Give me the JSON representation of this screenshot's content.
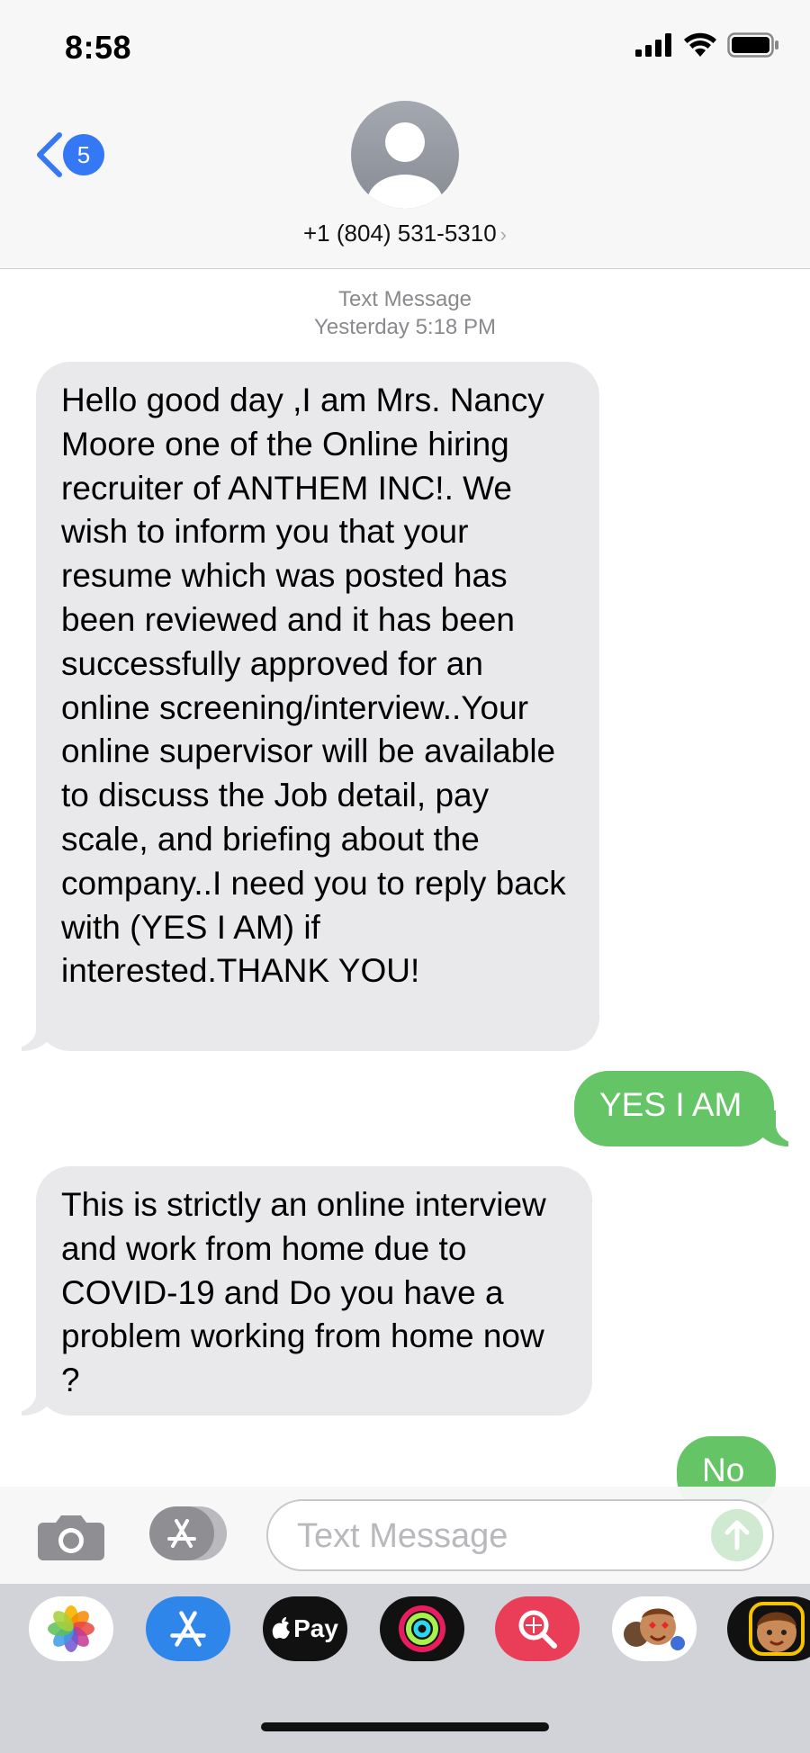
{
  "status": {
    "time": "8:58"
  },
  "header": {
    "back_badge": "5",
    "contact": "+1 (804) 531-5310"
  },
  "thread": {
    "stamp_type": "Text Message",
    "stamp_time": "Yesterday 5:18 PM",
    "messages": [
      {
        "from": "them",
        "text": "Hello good day ,I am Mrs. Nancy Moore one of the Online hiring recruiter of ANTHEM INC!. We wish to  inform you that your resume which was posted has been reviewed and it has been successfully approved for an online screening/interview..Your online supervisor will be available to discuss the Job detail, pay scale, and briefing about the company..I need you to reply back with (YES I AM) if interested.THANK YOU!"
      },
      {
        "from": "me",
        "text": "YES I AM"
      },
      {
        "from": "them",
        "text": "This is strictly an online interview and work from home due to COVID-19 and Do you have a problem working from home now ?"
      },
      {
        "from": "me",
        "text": "No"
      }
    ]
  },
  "composer": {
    "placeholder": "Text Message"
  },
  "drawer": {
    "apps": [
      "photos-icon",
      "app-store-icon",
      "apple-pay-icon",
      "activity-icon",
      "web-images-icon",
      "memoji-stickers-icon",
      "memoji-icon"
    ],
    "apple_pay_label": "Pay"
  },
  "colors": {
    "incoming": "#e9e9eb",
    "outgoing": "#65c466",
    "accent": "#3478f6"
  }
}
